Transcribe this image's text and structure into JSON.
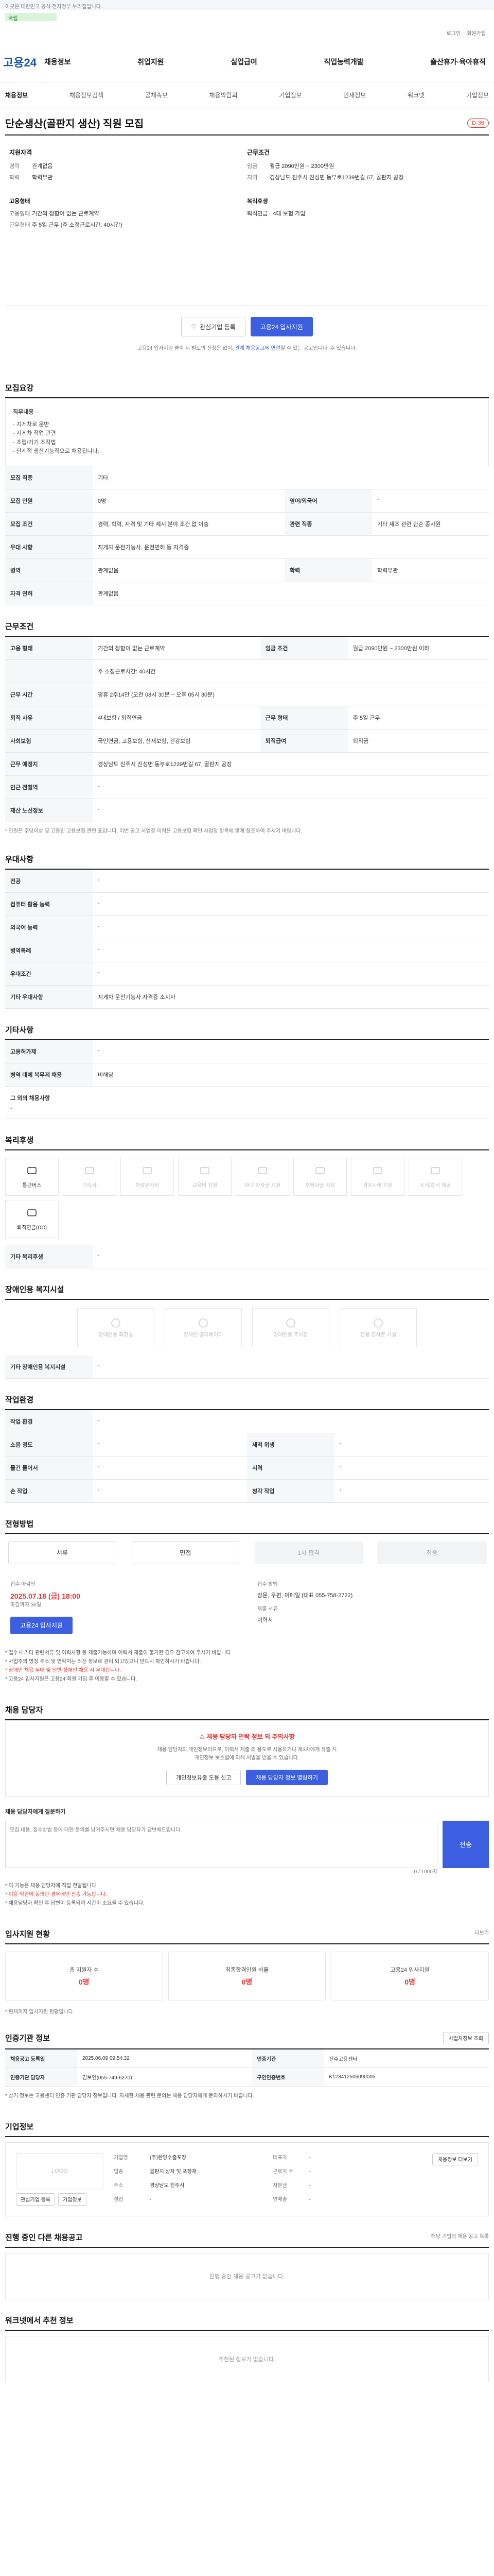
{
  "topbar": {
    "text": "이곳은 대한민국 공식 전자정부 누리집입니다."
  },
  "gov": {
    "flag": "국립",
    "sep": "|"
  },
  "util": [
    "로그인",
    "회원가입"
  ],
  "logo": "고용24",
  "gnb": [
    "채용정보",
    "취업지원",
    "실업급여",
    "직업능력개발",
    "출산휴가·육아휴직"
  ],
  "subnav": [
    "채용정보",
    "채용정보검색",
    "공채속보",
    "채용박람회",
    "기업정보",
    "인재정보",
    "워크넷",
    "기업정보"
  ],
  "job": {
    "title": "단순생산(골판지 생산) 직원 모집",
    "dday": "D-36"
  },
  "summary": {
    "company_title": "지원자격",
    "company_rows": [
      {
        "k": "경력",
        "v": "관계없음"
      },
      {
        "k": "학력",
        "v": "학력무관"
      }
    ],
    "emp_title": "고용형태",
    "emp_rows": [
      {
        "k": "고용형태",
        "v": "기간의 정함이 없는 근로계약"
      },
      {
        "k": "근무형태",
        "v": "주 5일 근무 (주 소정근로시간: 40시간)"
      }
    ],
    "cond_title": "근무조건",
    "cond_rows": [
      {
        "k": "임금",
        "v": "월급 2090만원 ~ 2300만원"
      },
      {
        "k": "지역",
        "v": "경상남도 진주시 진성면 동부로1239번길 67, 골판지 공장"
      }
    ],
    "welfare_title": "복리후생",
    "welfare_tags": [
      "퇴직연금",
      "4대 보험 가입"
    ]
  },
  "actions": {
    "interest": "관심기업 등록",
    "apply": "고용24 입사지원"
  },
  "notice": {
    "pre": "고용24 입사지원 클릭 시 별도의 신청은 없이,",
    "link": "관계 채용공고에 연결",
    "post": "할 수 있는 공고입니다. 수 있습니다."
  },
  "s1": {
    "h": "모집요강",
    "work_h": "직무내용",
    "work_lines": [
      "- 지게차로 운반",
      "- 지게차 작업 관련",
      "- 조립/기기 조작법",
      "- 단계적 생산기능직으로 채용됩니다."
    ],
    "rows": [
      {
        "k": "모집 직종",
        "v": "기타",
        "k2": "",
        "v2": ""
      },
      {
        "k": "모집 인원",
        "v": "0명",
        "k2": "영어/외국어",
        "v2": "-"
      },
      {
        "k": "모집 조건",
        "v": "경력, 학력, 자격 및 기타 제시 분야 조건 없 이충",
        "k2": "관련 직종",
        "v2": "기타 제조 관련 단순 종사원"
      },
      {
        "k": "우대 사항",
        "v": "지게차 운전기능사, 운전면허 등 자격증",
        "k2": "",
        "v2": ""
      },
      {
        "k": "병역",
        "v": "관계없음",
        "k2": "학력",
        "v2": "학력무관"
      },
      {
        "k": "자격 면허",
        "v": "관계없음",
        "k2": "",
        "v2": ""
      }
    ]
  },
  "s2": {
    "h": "근무조건",
    "rows": [
      {
        "k": "고용 형태",
        "v": "기간의 정함이 없는 근로계약",
        "k2": "임금 조건",
        "v2": "월급 2090만원 ~ 2300만원 이하"
      },
      {
        "k": "",
        "v": "주 소정근로시간: 40시간",
        "k2": "",
        "v2": ""
      },
      {
        "k": "근무 시간",
        "v": "평휴 2주14만 (오전 08시 30분 ~ 오후 05시 30분)",
        "k2": "",
        "v2": ""
      },
      {
        "k": "퇴직 사유",
        "v": "4대보험 / 퇴직연금",
        "k2": "근무 형태",
        "v2": "주 5일 근무"
      },
      {
        "k": "사회보험",
        "v": "국민연금, 고용보험, 산재보험, 건강보험",
        "k2": "퇴직급여",
        "v2": "퇴직금"
      },
      {
        "k": "근무 예정지",
        "v": "경상남도 진주시 진성면 동부로1239번길 67, 골판지 공장",
        "k2": "",
        "v2": ""
      },
      {
        "k": "인근 전철역",
        "v": "-",
        "k2": "",
        "v2": ""
      },
      {
        "k": "재산 노선정보",
        "v": "-",
        "k2": "",
        "v2": ""
      }
    ],
    "note": "* 인원은 주당이상 및 고용인 고용보험 관련 표입니다. 이번 공고 사업장 이력은 고용보험 확인 사업장 항목에 맞게 참조하여 주시기 바랍니다."
  },
  "s3": {
    "h": "우대사항",
    "rows": [
      {
        "k": "전공",
        "v": "-"
      },
      {
        "k": "컴퓨터 활용 능력",
        "v": "-"
      },
      {
        "k": "외국어 능력",
        "v": "-"
      },
      {
        "k": "병역특례",
        "v": "-"
      },
      {
        "k": "우대조건",
        "v": "-"
      },
      {
        "k": "기타 우대사항",
        "v": "지게차 운전기능사 자격증 소지자"
      }
    ]
  },
  "s4": {
    "h": "기타사항",
    "rows": [
      {
        "k": "고용허가제",
        "v": "-"
      },
      {
        "k": "병역 대체 복무제 채용",
        "v": "비해당"
      }
    ],
    "sub_h": "그 외의 채용사항",
    "sub_v": "-"
  },
  "s5": {
    "h": "복리후생",
    "items": [
      {
        "label": "통근버스",
        "on": true
      },
      {
        "label": "기숙사",
        "on": false
      },
      {
        "label": "차량유지비",
        "on": false
      },
      {
        "label": "교육비 지원",
        "on": false
      },
      {
        "label": "자녀 학자금 지원",
        "on": false
      },
      {
        "label": "주택자금 지원",
        "on": false
      },
      {
        "label": "경조사비 지원",
        "on": false
      },
      {
        "label": "조식/중식 제공",
        "on": false
      },
      {
        "label": "퇴직연금(DC)",
        "on": true
      }
    ],
    "etc_k": "기타 복리후생",
    "etc_v": "-"
  },
  "s6": {
    "h": "장애인용 복지시설",
    "items": [
      "장애인용 화장실",
      "장애인 엘리베이터",
      "장애인용 주차장",
      "전용 경사로 시설"
    ],
    "etc_k": "기타 장애인용 복지시설",
    "etc_v": "-"
  },
  "s7": {
    "h": "작업환경",
    "rows": [
      {
        "k": "작업 환경",
        "v": "-",
        "k2": "",
        "v2": ""
      },
      {
        "k": "소음 정도",
        "v": "-",
        "k2": "세척 위생",
        "v2": "-"
      },
      {
        "k": "물건 들어서",
        "v": "-",
        "k2": "시력",
        "v2": "-"
      },
      {
        "k": "손 작업",
        "v": "-",
        "k2": "청각 작업",
        "v2": "-"
      }
    ]
  },
  "s8": {
    "h": "전형방법",
    "steps": [
      "서류",
      "면접",
      "1차 합격",
      "최종"
    ],
    "deadline_k": "접수 마감일",
    "deadline": "2025.07.18 (금) 18:00",
    "deadline_s": "마감까지 36일",
    "method_k": "접수 방법",
    "method": "방문, 우편, 이메일 (대표 055-758-2722)",
    "method2_k": "제출 서류",
    "method2": "이력서",
    "apply_btn": "고용24 입사지원",
    "notes": [
      "* 접수시 기타 관련서류 및 이력사항 등 제출가능하며 이력서 제출이 불가한 경우 참고하여 주시기 바랍니다.",
      "* 사업주의 명칭 주소 및 연락처는 최신 정보로 관리 되고있으니 반드시 확인하시기 바랍니다.",
      "* 장애인 채용 우대 및 일반 장애인 채용 시 우대합니다.",
      "* 고용24 입사지원은 고용24 회원 가입 후 이용할 수 있습니다."
    ]
  },
  "s9": {
    "h": "채용 담당자",
    "warn_t": "채용 담당자 연락 정보 외 주의사항",
    "warn_d1": "채용 담당자의 개인정보이므로, 이력서 제출 외 용도로 사용하거나 제3자에게 유출 시",
    "warn_d2": "개인정보 보호법에 의해 처벌을 받을 수 있습니다.",
    "b1": "개인정보유출 도용 신고",
    "b2": "채용 담당자 정보 열람하기",
    "inq_h": "채용 담당자에게 질문하기",
    "inq_ph": "모집 내용, 접수방법 등에 대한 문의를 남겨주시면 채용 담당자가 답변해드립니다.",
    "inq_cnt": "0 / 1000자",
    "inq_send": "전송",
    "inq_notes": [
      "* 이 기능은 채용 담당자에 직접 전달됩니다.",
      "* 이용 약관에 동의한 경우에만 전송 가능합니다.",
      "* 채용담당자 확인 후 답변이 등록되며 시간이 소요될 수 있습니다."
    ]
  },
  "s10": {
    "h": "입사지원 현황",
    "more": "더보기",
    "stats": [
      {
        "l": "총 지원자 수",
        "v": "0명"
      },
      {
        "l": "최종합격인원 비율",
        "v": "0명"
      },
      {
        "l": "고용24 입사지원",
        "v": "0명"
      }
    ],
    "note": "* 현재까지 입사지원 현황입니다."
  },
  "s11": {
    "h": "인증기관 정보",
    "btn": "사업자정보 조회",
    "rows": [
      {
        "k": "채용공고 등록일",
        "v": "2025.06.09 09:54:32",
        "k2": "인증기관",
        "v2": "진주고용센터"
      },
      {
        "k": "인증기관 담당자",
        "v": "김보연(055-749-6270)",
        "k2": "구인인증번호",
        "v2": "K123412506090005"
      }
    ],
    "note": "* 상기 정보는 고용센터 인증 기관 담당자 정보입니다. 자세한 채용 관련 문의는 채용 담당자에게 문의하시기 바랍니다."
  },
  "s12": {
    "h": "기업정보",
    "logo": "LOGO",
    "b1": "관심기업 등록",
    "b2": "기업정보",
    "btn": "채용정보 더보기",
    "info": [
      {
        "k": "기업명",
        "v": "(주)한양수출포장"
      },
      {
        "k": "대표자",
        "v": "-"
      },
      {
        "k": "업종",
        "v": "골판지 상자 및 포장재"
      },
      {
        "k": "근로자 수",
        "v": "-"
      },
      {
        "k": "주소",
        "v": "경상남도 진주시"
      },
      {
        "k": "자본금",
        "v": "-"
      },
      {
        "k": "설립",
        "v": "-"
      },
      {
        "k": "연매출",
        "v": "-"
      }
    ]
  },
  "s13": {
    "h": "진행 중인 다른 채용공고",
    "sub": "해당 기업의 채용 공고 목록",
    "empty": "진행 중인 채용 공고가 없습니다."
  },
  "s14": {
    "h": "워크넷에서 추천 정보",
    "empty": "추천된 정보가 없습니다."
  }
}
